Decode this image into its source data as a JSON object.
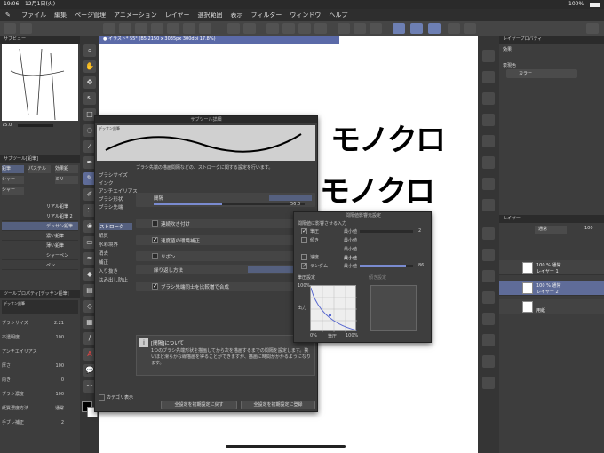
{
  "status": {
    "time": "19:06",
    "date": "12月1日(火)",
    "battery": "100%"
  },
  "menu": [
    "ファイル",
    "編集",
    "ページ管理",
    "アニメーション",
    "レイヤー",
    "選択範囲",
    "表示",
    "フィルター",
    "ウィンドウ",
    "ヘルプ"
  ],
  "document": {
    "tab": "● イラスト* 55° (B5 2150 x 3035px 300dpi 17.8%)"
  },
  "left_panel": {
    "navigator_title": "サブビュー",
    "zoom": "75.0",
    "subtool_title": "サブツール[鉛筆]",
    "subtool_tabs": [
      "鉛筆",
      "パステル",
      "シャー",
      "効果鉛",
      "シャー",
      "ミリ"
    ],
    "brushes": [
      "リアル鉛筆",
      "リアル鉛筆 2",
      "デッサン鉛筆",
      "濃い鉛筆",
      "薄い鉛筆",
      "シャーペン",
      "ペン"
    ],
    "toolprop_title": "ツールプロパティ[デッサン鉛筆]",
    "toolprop_brush": "デッサン鉛筆",
    "props": [
      {
        "label": "ブラシサイズ",
        "value": "2.21",
        "fill": 0.3
      },
      {
        "label": "不透明度",
        "value": "100",
        "fill": 1.0
      },
      {
        "label": "アンチエイリアス",
        "value": ""
      },
      {
        "label": "厚さ",
        "value": "100",
        "fill": 1.0
      },
      {
        "label": "向き",
        "value": "0",
        "fill": 0.0
      },
      {
        "label": "ブラシ濃度",
        "value": "100",
        "fill": 1.0
      },
      {
        "label": "紙質濃度方法",
        "value": "通常"
      },
      {
        "label": "手ブレ補正",
        "value": "2"
      }
    ]
  },
  "canvas_text": [
    "モノクロ",
    "モノクロ"
  ],
  "dialog": {
    "title": "サブツール詳細",
    "preview_tag": "デッサン鉛筆",
    "categories": [
      "ブラシサイズ",
      "インク",
      "アンチエイリアス",
      "ブラシ形状",
      "ブラシ先端",
      "ストローク",
      "紙質",
      "水彩境界",
      "消去",
      "補正",
      "入り抜き",
      "はみ出し防止"
    ],
    "description": "ブラシ先端の描画間隔などの、ストロークに関する設定を行います。",
    "rows": [
      {
        "label": "間隔",
        "value": "56.0",
        "checked": false
      },
      {
        "label": "連続吹き付け",
        "checked": false
      },
      {
        "label": "速度値の環境補正",
        "checked": true
      },
      {
        "label": "リボン",
        "checked": false
      },
      {
        "label": "繰り返し方法",
        "checked": false
      },
      {
        "label": "ブラシ先端同士を比較増で合成",
        "checked": true
      }
    ],
    "info_title": "[間隔]について",
    "info_text": "1つのブラシ先端形状を描画してから次を描画するまでの間隔を設定します。狭いほど滑らかな線描画を得ることができますが、描画に時間がかかるようになります。",
    "category_toggle": "カテゴリ表示",
    "reset_button": "全設定を初期設定に戻す",
    "register_button": "全設定を初期設定に登録"
  },
  "popup": {
    "title": "間隔値影響元設定",
    "subtitle": "間隔値に影響させる入力",
    "inputs": [
      {
        "label": "筆圧",
        "checked": true,
        "min_label": "最小値",
        "value": "2"
      },
      {
        "label": "傾き",
        "checked": false,
        "min_label": "最小値",
        "value": ""
      },
      {
        "label": "",
        "checked": false,
        "min_label": "最小値",
        "value": ""
      },
      {
        "label": "",
        "checked": false,
        "min_label": "最小値",
        "value": ""
      },
      {
        "label": "速度",
        "checked": false,
        "min_label": "最小値",
        "value": ""
      },
      {
        "label": "ランダム",
        "checked": true,
        "min_label": "最小値",
        "value": "86"
      }
    ],
    "graph1_title": "筆圧設定",
    "graph2_title": "傾き設定",
    "graph_y_max": "100%",
    "graph_y_label": "出力",
    "graph_x_min": "0%",
    "graph_x_label": "筆圧",
    "graph_x_max": "100%"
  },
  "right_panel": {
    "layerprop_title": "レイヤープロパティ",
    "effect_label": "効果",
    "expression_label": "表現色",
    "expression_value": "カラー",
    "layer_title": "レイヤー",
    "blend_mode": "通常",
    "opacity": "100",
    "layers": [
      {
        "opacity": "100 % 通常",
        "name": "レイヤー 1",
        "selected": false
      },
      {
        "opacity": "100 % 通常",
        "name": "レイヤー 2",
        "selected": true
      },
      {
        "opacity": "",
        "name": "用紙",
        "selected": false
      }
    ]
  },
  "colors": {
    "accent": "#6d7fb3",
    "selection": "#5f6c99",
    "panel": "#3d3d3d"
  }
}
